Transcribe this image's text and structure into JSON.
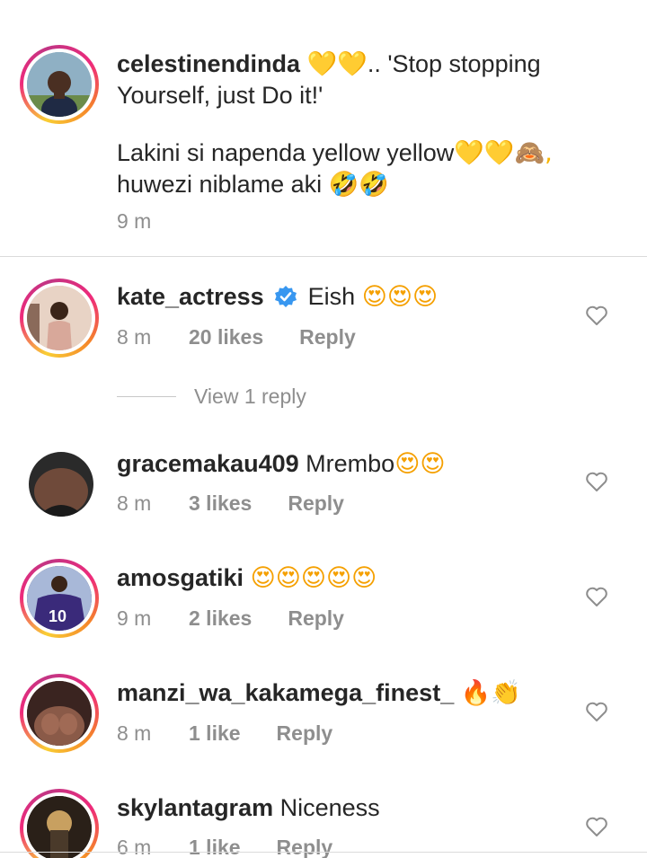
{
  "comments": [
    {
      "user": "celestinendinda",
      "text_line1_emoji": "💛💛",
      "text_line1": ".. 'Stop stopping Yourself, just Do it!'",
      "text_line2": "Lakini si napenda yellow yellow",
      "text_line2_emoji": "💛💛🙈,",
      "text_line3": "huwezi niblame aki",
      "text_line3_emoji": "🤣🤣",
      "time": "9 m"
    },
    {
      "user": "kate_actress",
      "text": "Eish",
      "emoji": "😍😍😍",
      "time": "8 m",
      "likes": "20 likes",
      "reply": "Reply",
      "view_replies": "View 1 reply"
    },
    {
      "user": "gracemakau409",
      "text": "Mrembo",
      "emoji": "😍😍",
      "time": "8 m",
      "likes": "3 likes",
      "reply": "Reply"
    },
    {
      "user": "amosgatiki",
      "text": "",
      "emoji": "😍😍😍😍😍",
      "time": "9 m",
      "likes": "2 likes",
      "reply": "Reply"
    },
    {
      "user": "manzi_wa_kakamega_finest_",
      "text": "",
      "emoji": "🔥👏",
      "time": "8 m",
      "likes": "1 like",
      "reply": "Reply"
    },
    {
      "user": "skylantagram",
      "text": "Niceness",
      "emoji": "",
      "time": "6 m",
      "likes": "1 like",
      "reply": "Reply"
    }
  ],
  "icons": {
    "like": "heart-outline-icon",
    "verified": "verified-badge-icon"
  },
  "colors": {
    "username": "#262626",
    "meta": "#8e8e8e",
    "verified": "#3897f0",
    "story_ring": "#ee2a7b"
  }
}
